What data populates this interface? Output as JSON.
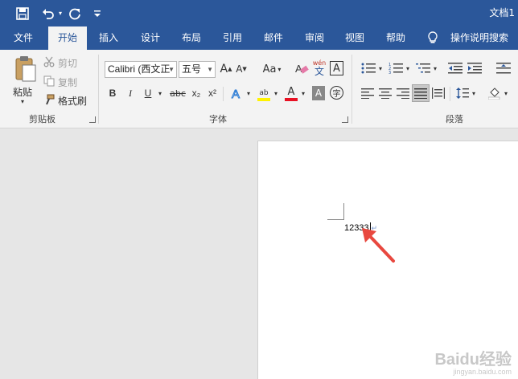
{
  "title_bar": {
    "doc_title": "文档1",
    "save_icon": "save-icon",
    "undo_icon": "undo-icon",
    "redo_icon": "redo-icon",
    "customize_icon": "customize-qat-icon"
  },
  "tabs": [
    {
      "label": "文件"
    },
    {
      "label": "开始"
    },
    {
      "label": "插入"
    },
    {
      "label": "设计"
    },
    {
      "label": "布局"
    },
    {
      "label": "引用"
    },
    {
      "label": "邮件"
    },
    {
      "label": "审阅"
    },
    {
      "label": "视图"
    },
    {
      "label": "帮助"
    }
  ],
  "tell_me": {
    "label": "操作说明搜索"
  },
  "clipboard": {
    "paste": "粘贴",
    "cut": "剪切",
    "copy": "复制",
    "format_painter": "格式刷",
    "group_label": "剪贴板"
  },
  "font": {
    "font_name": "Calibri (西文正",
    "font_size": "五号",
    "wen_char": "wén",
    "wen_main": "文",
    "A_glyph": "A",
    "Aa_glyph": "Aa",
    "bold": "B",
    "italic": "I",
    "underline": "U",
    "strike": "abc",
    "subscript": "x₂",
    "superscript": "x²",
    "highlight_glyph": "ab",
    "char_circle": "字",
    "group_label": "字体"
  },
  "paragraph": {
    "group_label": "段落"
  },
  "document": {
    "text": "12333"
  },
  "watermark": {
    "brand": "Baidu经验",
    "url": "jingyan.baidu.com"
  },
  "colors": {
    "brand_blue": "#2b579a",
    "ribbon_bg": "#f3f3f3",
    "font_color_red": "#e81123",
    "highlight_yellow": "#fff200",
    "arrow_red": "#e8483f"
  }
}
